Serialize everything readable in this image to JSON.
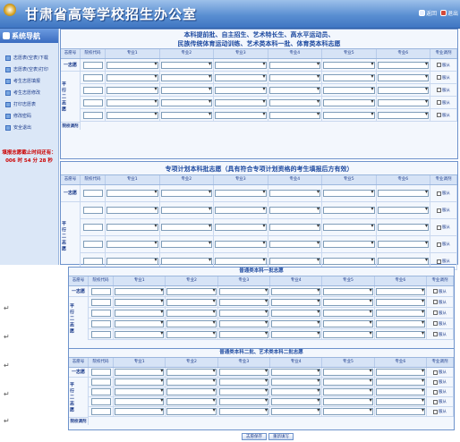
{
  "header": {
    "title": "甘肃省高等学校招生办公室",
    "btn_home": "返回",
    "btn_exit": "退出"
  },
  "sidebar": {
    "title": "系统导航",
    "items": [
      {
        "label": "志愿表(空表)下载"
      },
      {
        "label": "志愿表(空表)打印"
      },
      {
        "label": "考生志愿填报"
      },
      {
        "label": "考生志愿修改"
      },
      {
        "label": "打印志愿表"
      },
      {
        "label": "修改密码"
      },
      {
        "label": "安全退出"
      }
    ],
    "deadline_label": "填报志愿截止时间还有：",
    "deadline_value": "006 时 54 分 28 秒"
  },
  "section1": {
    "title_line1": "本科提前批、自主招生、艺术特长生、高水平运动员、",
    "title_line2": "民族传统体育运动训练、艺术类本科一批、体育类本科志愿"
  },
  "section2": {
    "title": "专项计划本科批志愿（具有符合专项计划资格的考生填报后方有效）"
  },
  "section3": {
    "title": "普通类本科一批志愿"
  },
  "section4": {
    "title": "普通类本科二批、艺术类本科二批志愿"
  },
  "columns": {
    "type": "志愿号",
    "code": "院校代码",
    "m1": "专业1",
    "m2": "专业2",
    "m3": "专业3",
    "m4": "专业4",
    "m5": "专业5",
    "m6": "专业6",
    "adjust": "专业调剂"
  },
  "rows": {
    "first": "一志愿",
    "parallel": "平行二志愿",
    "adjust_row": "院校调剂",
    "obey": "服从"
  },
  "buttons": {
    "save": "志愿保存",
    "reset": "重新填写"
  },
  "colors": {
    "header": "#4f86cf",
    "accent": "#1e4aa0",
    "deadline": "#cc0000"
  }
}
